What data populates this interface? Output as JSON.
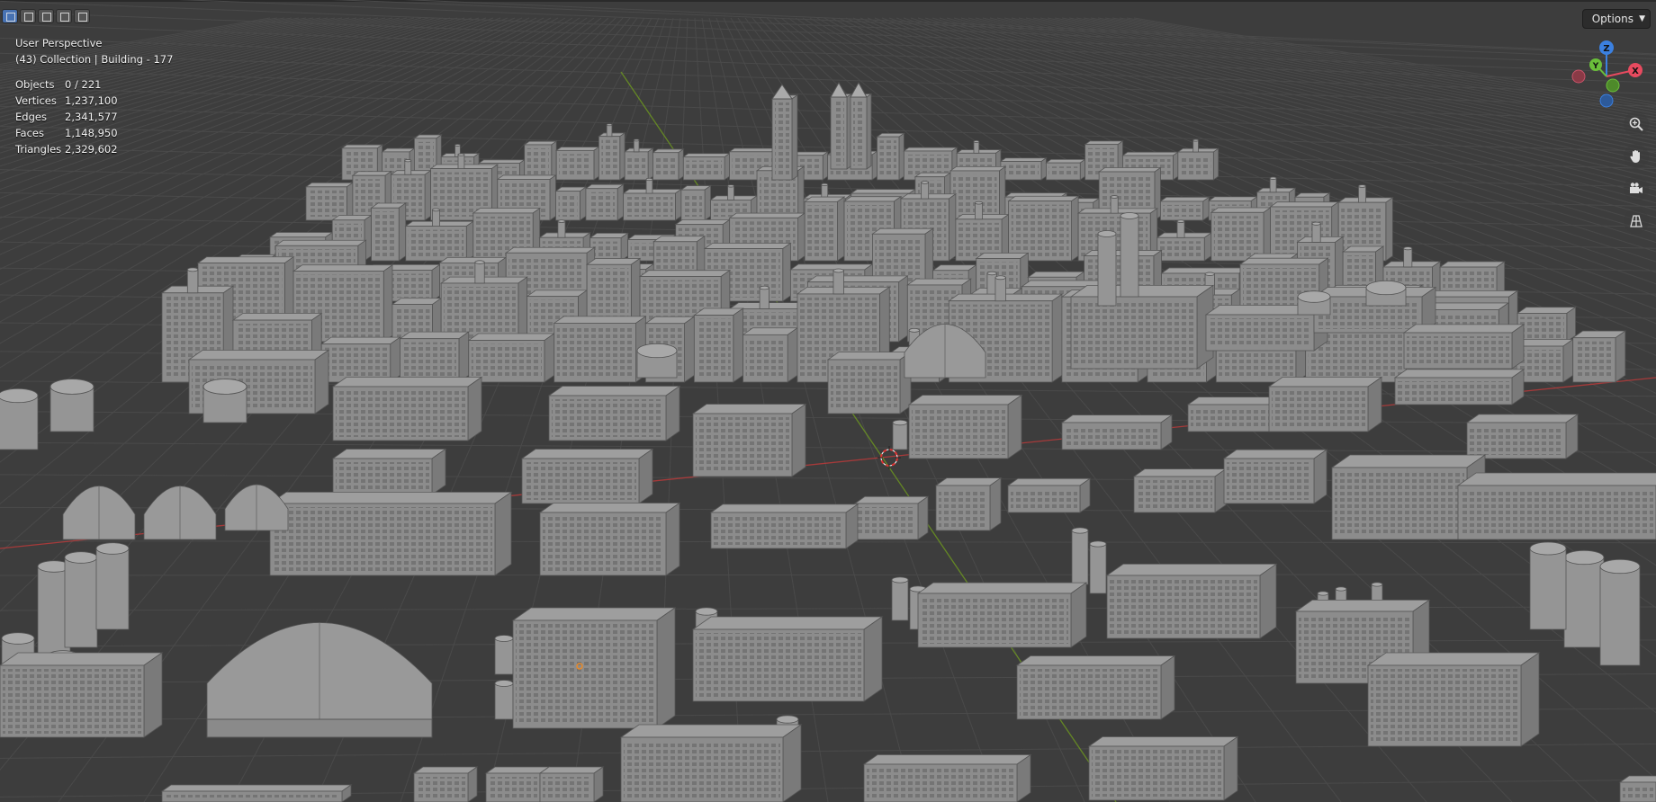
{
  "viewport": {
    "view_name": "User Perspective",
    "active_object": "(43) Collection | Building - 177",
    "stats": [
      {
        "label": "Objects",
        "value": "0 / 221"
      },
      {
        "label": "Vertices",
        "value": "1,237,100"
      },
      {
        "label": "Edges",
        "value": "2,341,577"
      },
      {
        "label": "Faces",
        "value": "1,148,950"
      },
      {
        "label": "Triangles",
        "value": "2,329,602"
      }
    ]
  },
  "header": {
    "options_label": "Options",
    "mode_buttons": [
      "select-box-icon",
      "select-extend-icon",
      "select-subtract-icon",
      "select-invert-icon",
      "select-intersect-icon"
    ]
  },
  "gizmo": {
    "axes": {
      "x": "X",
      "y": "Y",
      "z": "Z"
    },
    "colors": {
      "x": "#e84a5f",
      "y": "#6abf3a",
      "z": "#3b80e0"
    }
  },
  "tools": [
    "zoom-icon",
    "hand-pan-icon",
    "camera-icon",
    "grid-ortho-icon"
  ],
  "colors": {
    "background": "#3d3d3d",
    "grid": "#4a4a4a",
    "building": "#8c8c8c",
    "axis_red": "#c13a3a",
    "axis_green": "#6e9a1f"
  }
}
